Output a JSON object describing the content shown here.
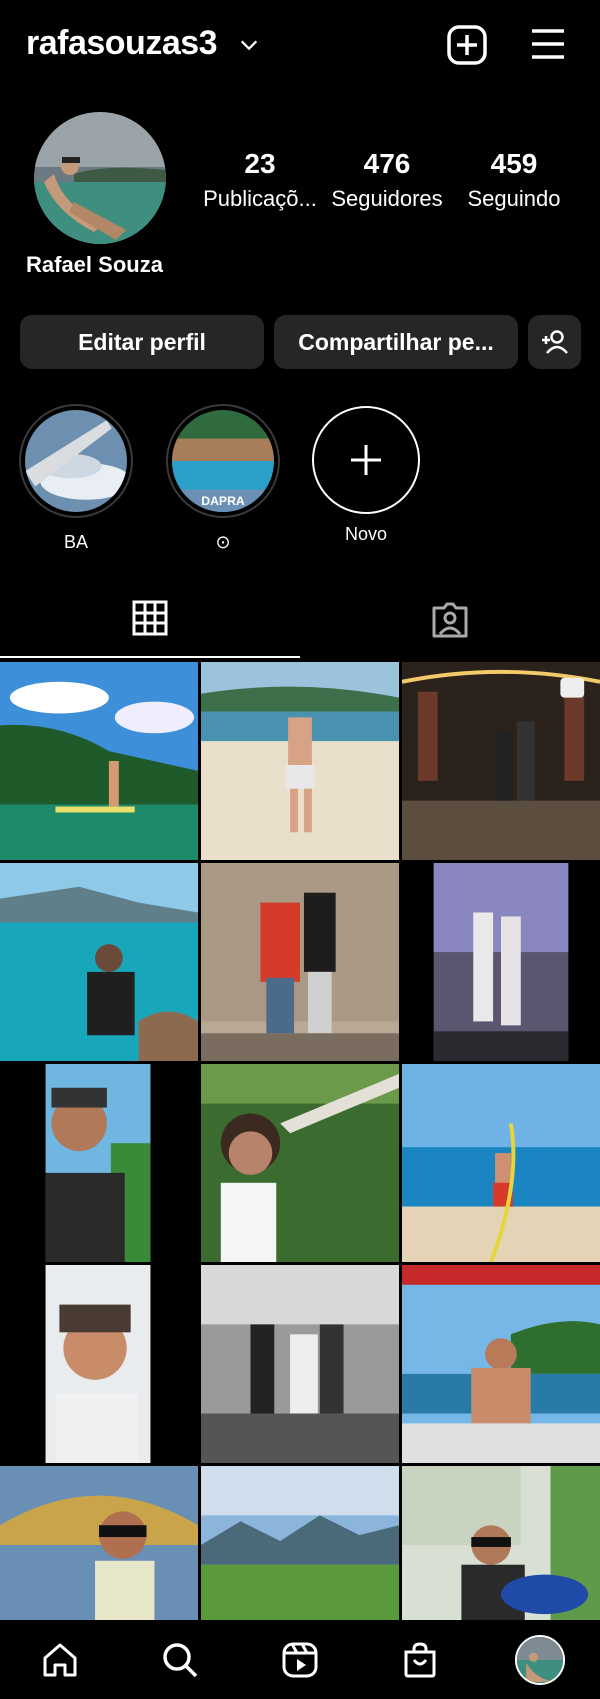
{
  "header": {
    "username": "rafasouzas3",
    "icons": [
      "chevron-down-icon",
      "plus-square-icon",
      "hamburger-menu-icon"
    ]
  },
  "profile": {
    "display_name": "Rafael Souza",
    "stats": [
      {
        "value": "23",
        "label": "Publicaçõ..."
      },
      {
        "value": "476",
        "label": "Seguidores"
      },
      {
        "value": "459",
        "label": "Seguindo"
      }
    ]
  },
  "actions": {
    "edit_label": "Editar perfil",
    "share_label": "Compartilhar pe...",
    "add_user_icon": "person-add-icon"
  },
  "highlights": [
    {
      "label": "BA",
      "icon": "airplane-window-image"
    },
    {
      "label": "⊙",
      "icon": "pool-image"
    },
    {
      "label": "Novo",
      "icon": "plus-icon"
    }
  ],
  "tabs": [
    {
      "name": "grid",
      "icon": "grid-icon",
      "active": true
    },
    {
      "name": "tagged",
      "icon": "tagged-person-icon",
      "active": false
    }
  ],
  "posts": [
    {
      "subject": "paddleboard-lake"
    },
    {
      "subject": "beach-man"
    },
    {
      "subject": "couple-lights",
      "multi": true
    },
    {
      "subject": "man-sitting-sea"
    },
    {
      "subject": "couple-wall"
    },
    {
      "subject": "couple-indoor"
    },
    {
      "subject": "selfie-cap"
    },
    {
      "subject": "child-swing"
    },
    {
      "subject": "beach-drawing"
    },
    {
      "subject": "selfie-cap-2"
    },
    {
      "subject": "wedding-bw"
    },
    {
      "subject": "boat-shirtless"
    },
    {
      "subject": "sunglasses-bridge"
    },
    {
      "subject": "mountains-field"
    },
    {
      "subject": "selfie-bonito"
    }
  ],
  "bottom_nav": [
    {
      "name": "home",
      "icon": "home-icon"
    },
    {
      "name": "search",
      "icon": "search-icon"
    },
    {
      "name": "reels",
      "icon": "reels-icon"
    },
    {
      "name": "shop",
      "icon": "shopping-bag-icon"
    },
    {
      "name": "profile",
      "icon": "profile-avatar"
    }
  ],
  "colors": {
    "background": "#000000",
    "button_bg": "#262626",
    "text": "#ffffff"
  }
}
